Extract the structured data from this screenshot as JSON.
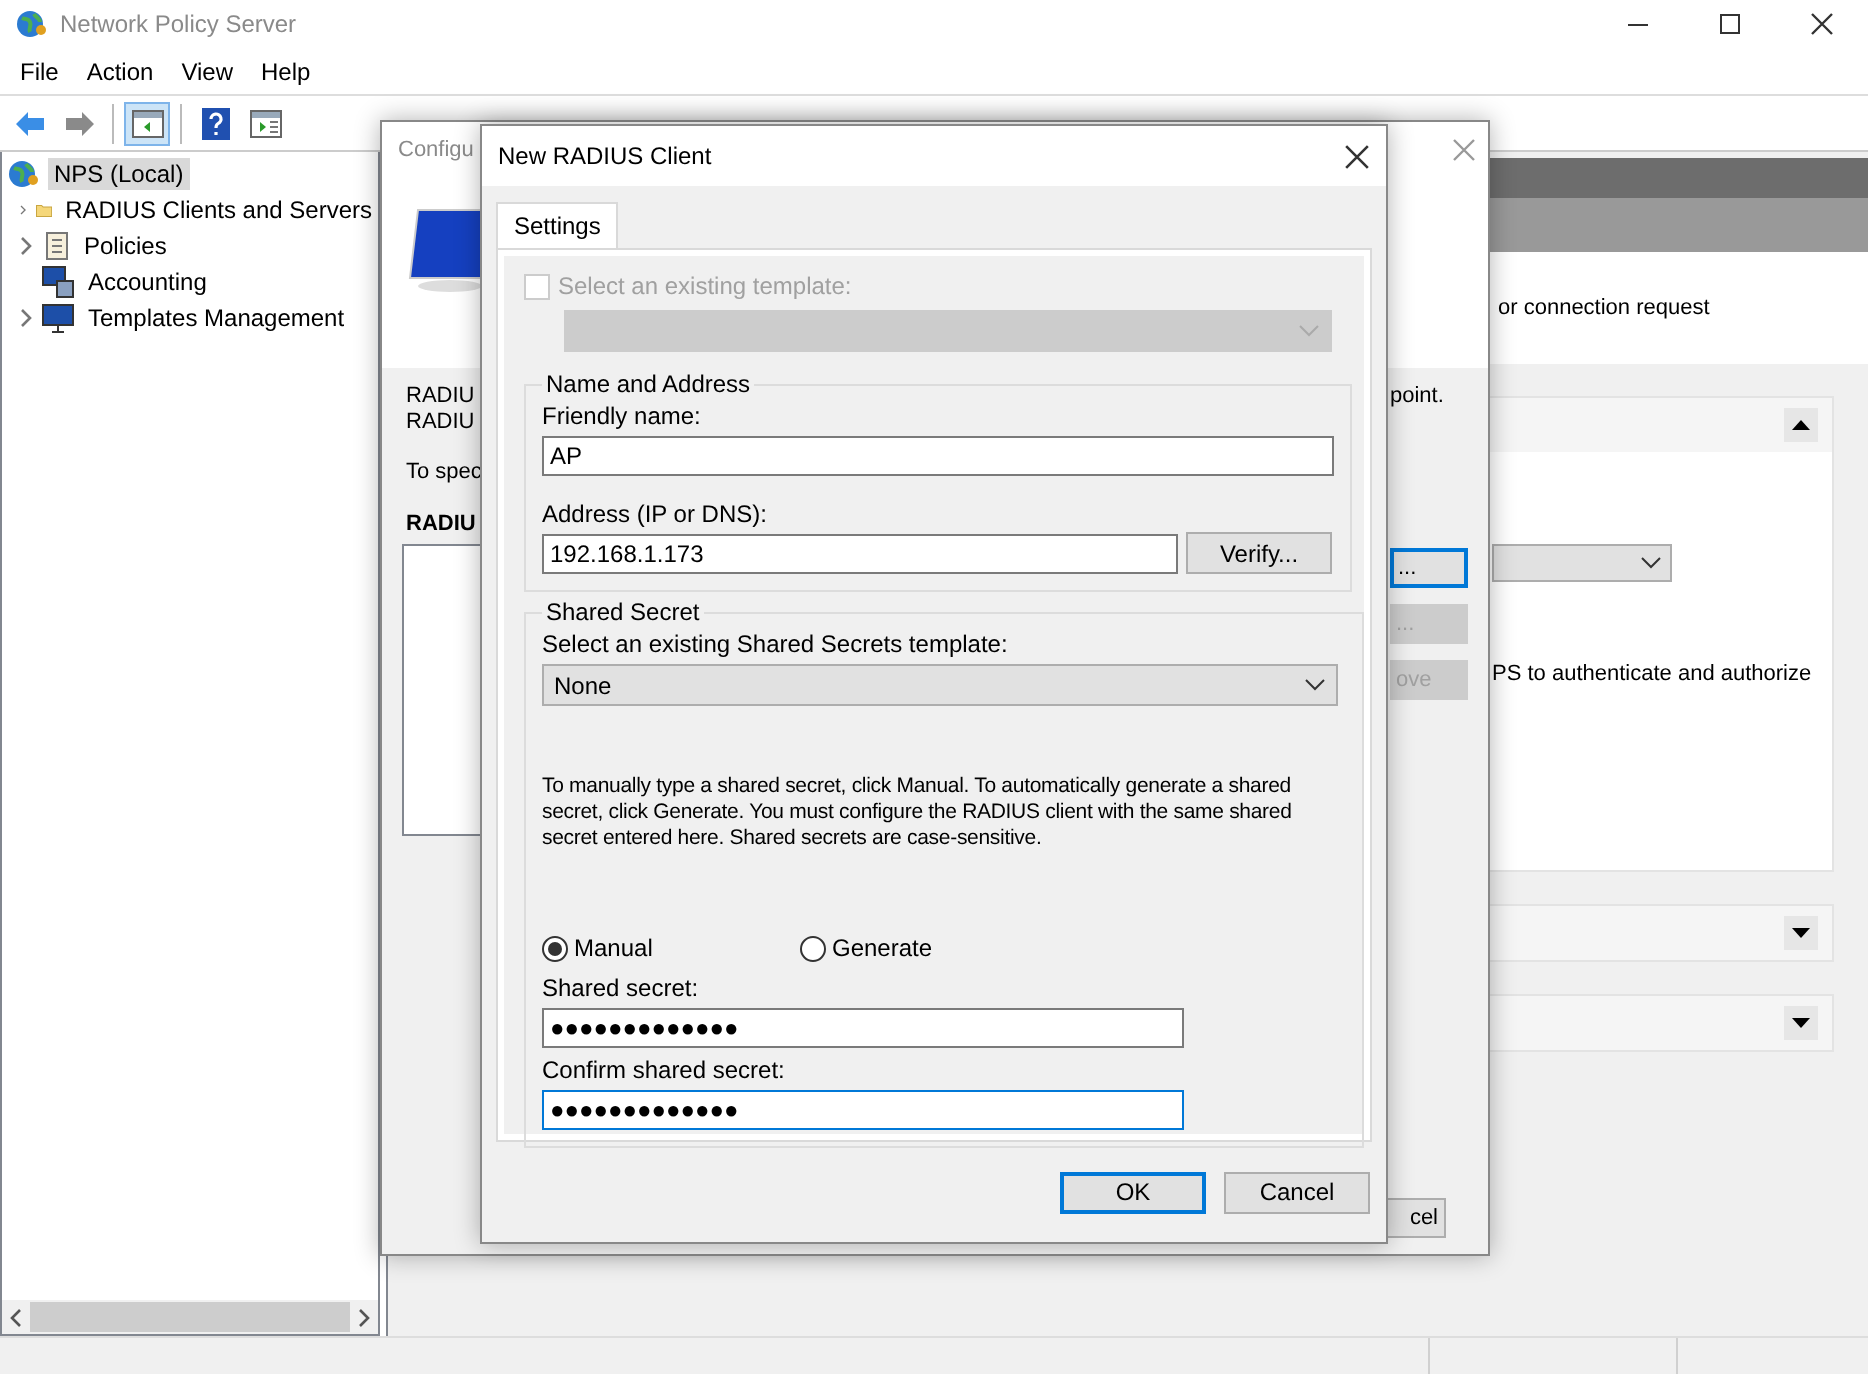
{
  "window": {
    "title": "Network Policy Server"
  },
  "menu": [
    "File",
    "Action",
    "View",
    "Help"
  ],
  "toolbar": [
    {
      "kind": "back",
      "selected": false
    },
    {
      "kind": "forward",
      "selected": false
    },
    {
      "kind": "pane",
      "selected": true
    },
    {
      "kind": "help",
      "selected": false
    },
    {
      "kind": "action-pane",
      "selected": false
    }
  ],
  "tree": {
    "label": "NPS (Local)",
    "selected": true,
    "children": [
      {
        "label": "RADIUS Clients and Servers",
        "kind": "folder",
        "expandable": true,
        "selected": false
      },
      {
        "label": "Policies",
        "kind": "policy",
        "expandable": true,
        "selected": false
      },
      {
        "label": "Accounting",
        "kind": "accounting",
        "expandable": false,
        "selected": false
      },
      {
        "label": "Templates Management",
        "kind": "templates",
        "expandable": true,
        "selected": false
      }
    ]
  },
  "details_pane": {
    "intro": "or connection request",
    "sections": [
      {
        "expanded": true,
        "text": "PS to authenticate and authorize"
      },
      {
        "expanded": false
      },
      {
        "expanded": false
      }
    ]
  },
  "background_dialog": {
    "title": "Configu",
    "lines": [
      "RADIU",
      "RADIU"
    ],
    "hint": "To spec",
    "list_heading": "RADIU",
    "right_text": "point.",
    "side_buttons": [
      {
        "label": "...",
        "disabled": false,
        "focused": true
      },
      {
        "label": "...",
        "disabled": true,
        "focused": false
      },
      {
        "label": "ove",
        "disabled": true,
        "focused": false
      }
    ],
    "bottom_button": {
      "label": "cel"
    }
  },
  "dialog": {
    "title": "New RADIUS Client",
    "tabs": [
      {
        "label": "Settings",
        "selected": true
      }
    ],
    "template": {
      "label": "Select an existing template:",
      "checked": false,
      "disabled": true
    },
    "name_group": {
      "title": "Name and Address",
      "friendly_label": "Friendly name:",
      "friendly_value": "AP",
      "address_label": "Address (IP or DNS):",
      "address_value": "192.168.1.173",
      "verify": "Verify..."
    },
    "secret_group": {
      "title": "Shared Secret",
      "template_label": "Select an existing Shared Secrets template:",
      "template_value": "None",
      "description": "To manually type a shared secret, click Manual. To automatically generate a shared secret, click Generate. You must configure the RADIUS client with the same shared secret entered here. Shared secrets are case-sensitive.",
      "modes": [
        {
          "label": "Manual",
          "selected": true
        },
        {
          "label": "Generate",
          "selected": false
        }
      ],
      "secret_label": "Shared secret:",
      "secret_value": "●●●●●●●●●●●●●",
      "confirm_label": "Confirm shared secret:",
      "confirm_value": "●●●●●●●●●●●●●"
    },
    "buttons": [
      {
        "label": "OK",
        "default": true
      },
      {
        "label": "Cancel",
        "default": false
      }
    ]
  }
}
